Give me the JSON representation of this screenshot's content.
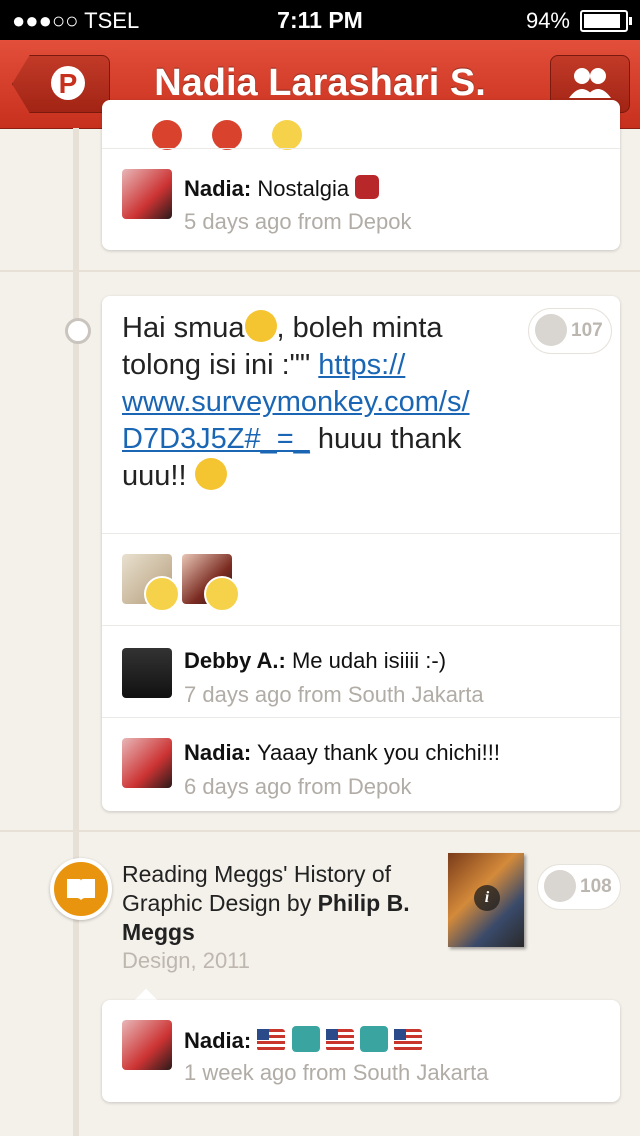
{
  "status_bar": {
    "carrier": "●●●○○ TSEL",
    "time": "7:11 PM",
    "battery": "94%"
  },
  "header": {
    "title": "Nadia Larashari S."
  },
  "comment_top": {
    "author": "Nadia:",
    "text": "Nostalgia",
    "meta": "5 days ago from Depok"
  },
  "post": {
    "text_before": "Hai smua",
    "text_after_emoji": ", boleh minta tolong isi ini :\"\" ",
    "link": "https://www.surveymonkey.com/s/D7D3J5Z#_=_",
    "link_line1": "https://",
    "link_line2": "www.surveymonkey.com/s/",
    "link_line3": "D7D3J5Z#_=_",
    "text_end": " huuu thank uuu!!",
    "smile_count": "107",
    "comments": [
      {
        "author": "Debby A.:",
        "text": "Me udah isiiii :-)",
        "meta": "7 days ago from South Jakarta"
      },
      {
        "author": "Nadia:",
        "text": "Yaaay thank you chichi!!!",
        "meta": "6 days ago from Depok"
      }
    ]
  },
  "book": {
    "title_prefix": "Reading Meggs' History of Graphic Design by ",
    "author": "Philip B. Meggs",
    "meta": "Design, 2011",
    "smile_count": "108",
    "comment": {
      "author": "Nadia:",
      "meta": "1 week ago from South Jakarta"
    }
  },
  "icons": {
    "back": "pinterest-back-icon",
    "people": "people-icon",
    "book": "book-icon",
    "smile": "smile-icon"
  },
  "colors": {
    "header": "#c8301e",
    "link": "#1a66b4",
    "book_badge": "#e9940f"
  }
}
